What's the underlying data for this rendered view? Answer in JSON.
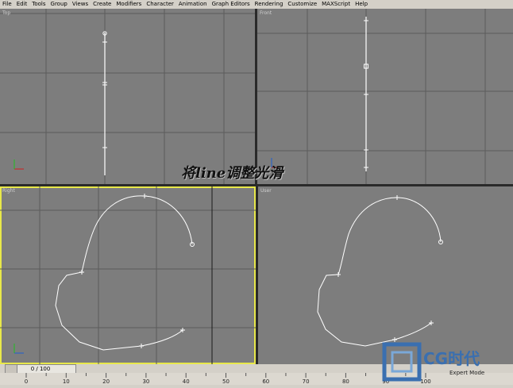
{
  "menu": [
    "File",
    "Edit",
    "Tools",
    "Group",
    "Views",
    "Create",
    "Modifiers",
    "Character",
    "Animation",
    "Graph Editors",
    "Rendering",
    "Customize",
    "MAXScript",
    "Help"
  ],
  "viewports": {
    "top_label": "Top",
    "front_label": "Front",
    "right_label": "Right",
    "user_label": "User"
  },
  "caption": "将line调整光滑",
  "timeline": {
    "frame_text": "0 / 100"
  },
  "ruler_ticks": [
    "0",
    "10",
    "20",
    "30",
    "40",
    "50",
    "60",
    "70",
    "80",
    "90",
    "100"
  ],
  "logo": {
    "brand": "CG时代",
    "subtitle": "Expert Mode"
  },
  "colors": {
    "viewport_bg": "#7d7d7d",
    "active_border": "#e8e84a",
    "grid": "#5a5a5a",
    "spline": "#ffffff"
  }
}
